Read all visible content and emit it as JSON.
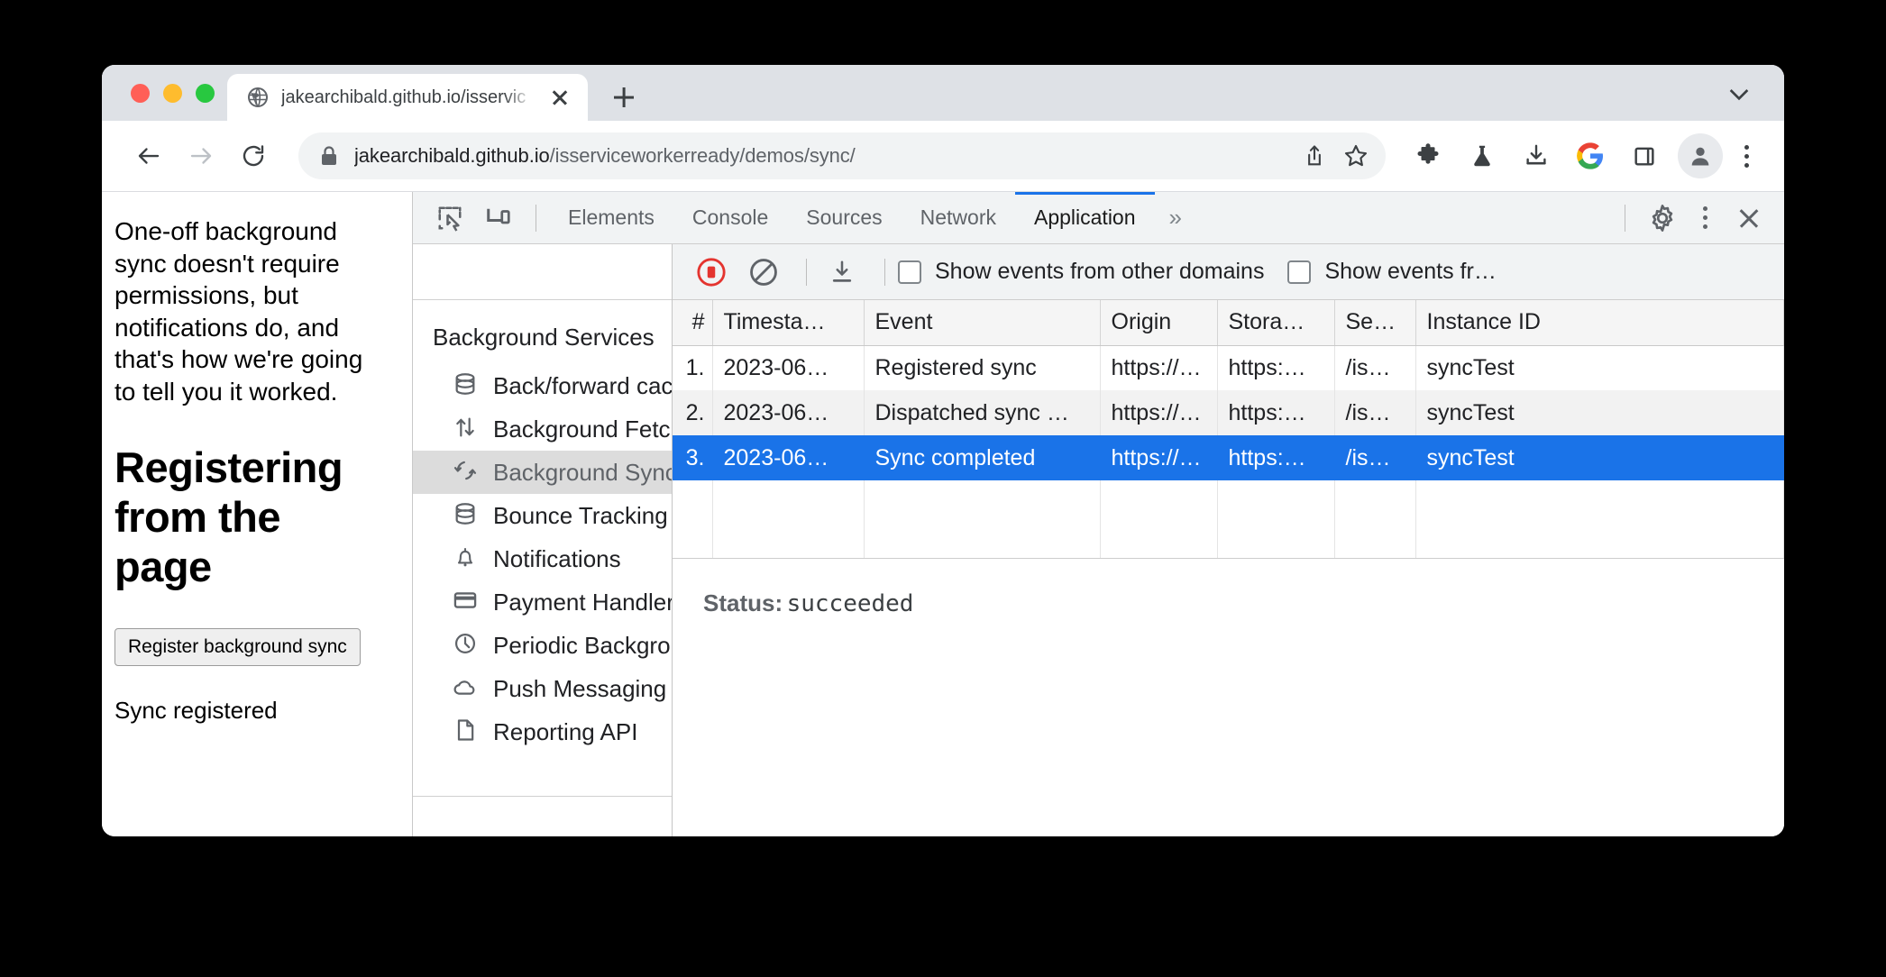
{
  "browser": {
    "traffic_lights": [
      "close",
      "minimize",
      "maximize"
    ],
    "tab": {
      "title": "jakearchibald.github.io/isservic",
      "favicon": "globe-icon",
      "close": "close-icon"
    },
    "new_tab_label": "+",
    "toolbar": {
      "back": "back-arrow-icon",
      "forward": "forward-arrow-icon",
      "reload": "reload-icon",
      "lock": "lock-icon",
      "url_host": "jakearchibald.github.io",
      "url_path": "/isserviceworkerready/demos/sync/",
      "share": "share-icon",
      "bookmark": "star-icon",
      "extensions": "puzzle-icon",
      "experiments": "flask-icon",
      "downloads": "download-icon",
      "google": "google-icon",
      "sidepanel": "side-panel-icon",
      "profile": "avatar-icon",
      "menu": "kebab-menu-icon"
    }
  },
  "page": {
    "paragraph": "One-off background sync doesn't require permissions, but notifications do, and that's how we're going to tell you it worked.",
    "heading": "Registering from the page",
    "button_label": "Register background sync",
    "status": "Sync registered"
  },
  "devtools": {
    "inspect_icon": "inspect-element-icon",
    "device_icon": "device-toolbar-icon",
    "tabs": [
      {
        "label": "Elements",
        "active": false
      },
      {
        "label": "Console",
        "active": false
      },
      {
        "label": "Sources",
        "active": false
      },
      {
        "label": "Network",
        "active": false
      },
      {
        "label": "Application",
        "active": true
      }
    ],
    "more_tabs": "»",
    "settings_icon": "gear-icon",
    "menu_icon": "kebab-menu-icon",
    "close_icon": "close-icon",
    "sidebar": {
      "group_title": "Background Services",
      "items": [
        {
          "label": "Back/forward cache",
          "icon": "database-icon",
          "selected": false
        },
        {
          "label": "Background Fetch",
          "icon": "up-down-arrows-icon",
          "selected": false
        },
        {
          "label": "Background Sync",
          "icon": "sync-icon",
          "selected": true
        },
        {
          "label": "Bounce Tracking Mi",
          "icon": "database-icon",
          "selected": false
        },
        {
          "label": "Notifications",
          "icon": "bell-icon",
          "selected": false
        },
        {
          "label": "Payment Handler",
          "icon": "credit-card-icon",
          "selected": false
        },
        {
          "label": "Periodic Backgroun",
          "icon": "clock-icon",
          "selected": false
        },
        {
          "label": "Push Messaging",
          "icon": "cloud-icon",
          "selected": false
        },
        {
          "label": "Reporting API",
          "icon": "document-icon",
          "selected": false
        }
      ]
    },
    "panel": {
      "record_icon": "record-stop-icon",
      "clear_icon": "clear-icon",
      "save_icon": "save-download-icon",
      "checkbox_other_domains": "Show events from other domains",
      "checkbox_other_storage": "Show events fr…",
      "columns": [
        "#",
        "Timesta…",
        "Event",
        "Origin",
        "Stora…",
        "Se…",
        "Instance ID"
      ],
      "rows": [
        {
          "num": "1.",
          "timestamp": "2023-06…",
          "event": "Registered sync",
          "origin": "https://…",
          "storage": "https:…",
          "sw": "/is…",
          "instance": "syncTest",
          "selected": false
        },
        {
          "num": "2.",
          "timestamp": "2023-06…",
          "event": "Dispatched sync …",
          "origin": "https://…",
          "storage": "https:…",
          "sw": "/is…",
          "instance": "syncTest",
          "selected": false
        },
        {
          "num": "3.",
          "timestamp": "2023-06…",
          "event": "Sync completed",
          "origin": "https://…",
          "storage": "https:…",
          "sw": "/is…",
          "instance": "syncTest",
          "selected": true
        }
      ],
      "detail_key": "Status:",
      "detail_value": "succeeded"
    }
  },
  "colors": {
    "accent": "#1a73e8",
    "record_red": "#e4342f",
    "tabstrip": "#dee1e6",
    "devtools_bg": "#f1f3f4"
  }
}
